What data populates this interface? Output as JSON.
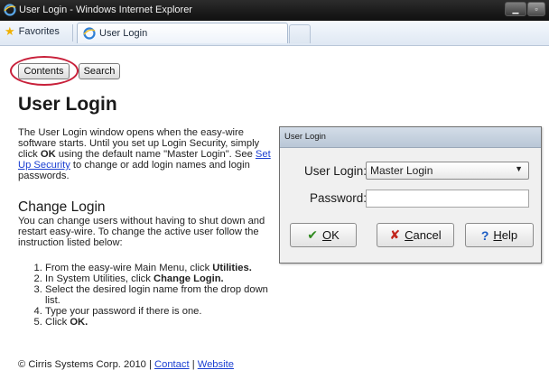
{
  "window": {
    "title": "User Login - Windows Internet Explorer"
  },
  "favorites_bar": {
    "favorites_label": "Favorites",
    "tab_label": "User Login"
  },
  "help_nav": {
    "contents_label": "Contents",
    "search_label": "Search"
  },
  "page": {
    "title": "User Login",
    "intro_text": "The User Login window opens when the easy-wire software starts. Until you set up Login Security, simply click ",
    "intro_bold_ok": "OK",
    "intro_text_2": " using the default name \"Master Login\". See ",
    "intro_link": "Set Up Security",
    "intro_text_3": " to change or add login names and login passwords.",
    "section_title": "Change Login",
    "section_text": "You can change users without having to shut down and restart easy-wire. To change the active user follow the instruction listed below:",
    "steps": [
      {
        "text": "From the easy-wire Main Menu, click ",
        "bold": "Utilities."
      },
      {
        "text": "In System Utilities, click ",
        "bold": "Change Login."
      },
      {
        "text": "Select the desired login name from the drop down list.",
        "bold": ""
      },
      {
        "text": "Type your password if there is one.",
        "bold": ""
      },
      {
        "text": "Click ",
        "bold": "OK."
      }
    ],
    "footer_text": "© Cirris Systems Corp. 2010 | ",
    "footer_contact": "Contact",
    "footer_sep": " | ",
    "footer_website": "Website"
  },
  "dialog": {
    "title": "User Login",
    "login_label": "User Login:",
    "login_value": "Master Login",
    "password_label": "Password:",
    "password_value": "",
    "ok_mnemonic": "O",
    "ok_rest": "K",
    "cancel_mnemonic": "C",
    "cancel_rest": "ancel",
    "help_mnemonic": "H",
    "help_rest": "elp"
  },
  "colors": {
    "highlight_ring": "#c8203a",
    "link": "#1b3fd1",
    "ok_check": "#2f8a1f",
    "cancel_x": "#c2261c",
    "help_q": "#1c5dc4"
  },
  "icons": [
    "ie-icon",
    "star-icon",
    "check-icon",
    "x-icon",
    "question-icon",
    "dropdown-arrow-icon",
    "minimize-icon",
    "maximize-icon"
  ]
}
